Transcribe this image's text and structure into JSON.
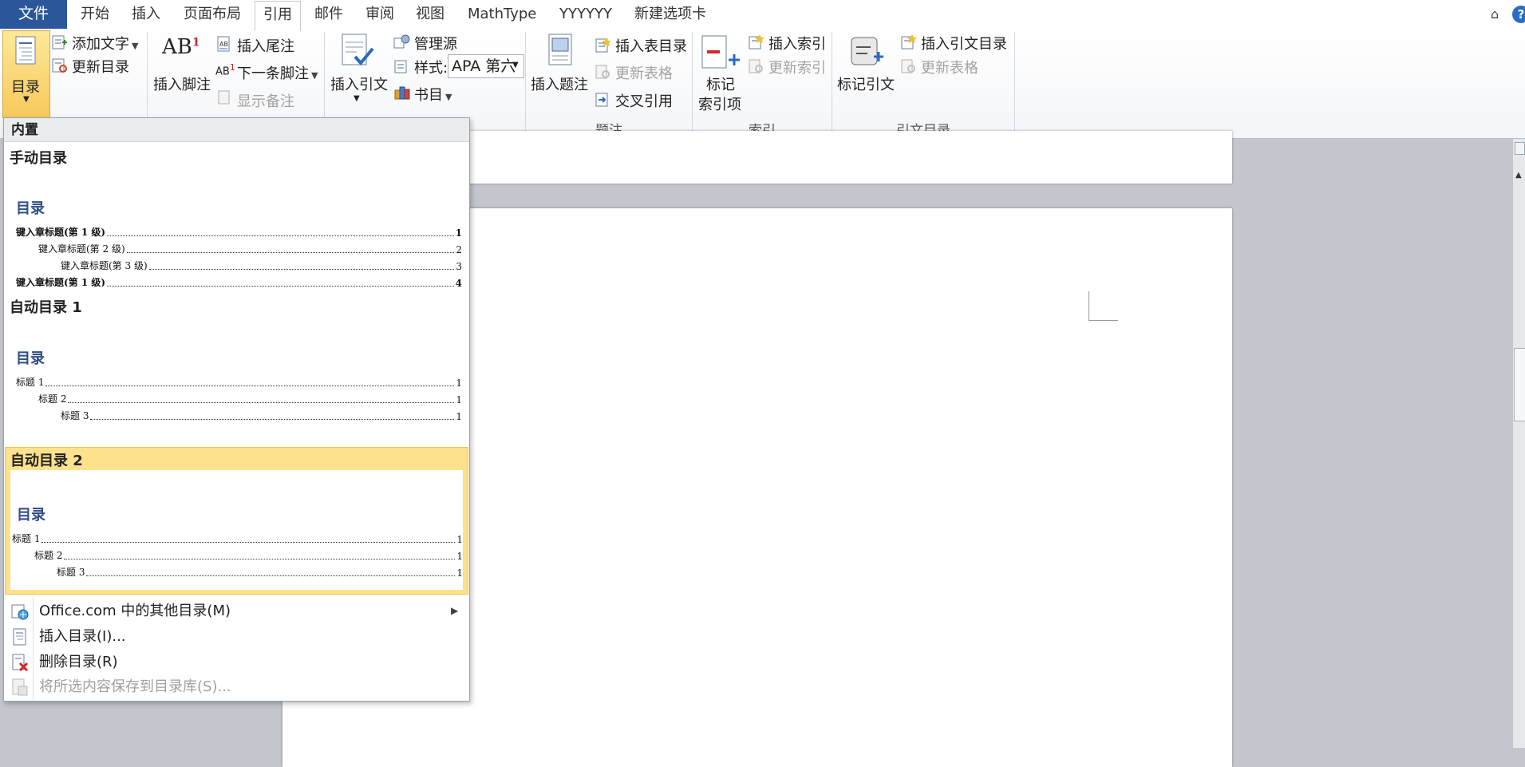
{
  "tabs": {
    "file": "文件",
    "items": [
      "开始",
      "插入",
      "页面布局",
      "引用",
      "邮件",
      "审阅",
      "视图",
      "MathType",
      "YYYYYY",
      "新建选项卡"
    ],
    "active_index": 3
  },
  "ribbon": {
    "toc_btn": "目录",
    "add_text": "添加文字",
    "update_toc": "更新目录",
    "insert_footnote": "插入脚注",
    "insert_endnote": "插入尾注",
    "next_footnote": "下一条脚注",
    "show_notes": "显示备注",
    "insert_citation": "插入引文",
    "manage_sources": "管理源",
    "style_label": "样式:",
    "style_value": "APA 第六",
    "bibliography": "书目",
    "insert_caption": "插入题注",
    "insert_table_of_figures": "插入表目录",
    "update_table": "更新表格",
    "cross_reference": "交叉引用",
    "group_captions": "题注",
    "mark_entry_1": "标记",
    "mark_entry_2": "索引项",
    "insert_index": "插入索引",
    "update_index": "更新索引",
    "group_index": "索引",
    "mark_citation": "标记引文",
    "insert_toa": "插入引文目录",
    "update_table2": "更新表格",
    "group_toa": "引文目录"
  },
  "dropdown": {
    "header": "内置",
    "manual": {
      "title": "手动目录",
      "toc_heading": "目录",
      "lines": [
        {
          "text": "键入章标题(第 1 级)",
          "page": "1"
        },
        {
          "text": "键入章标题(第 2 级)",
          "page": "2"
        },
        {
          "text": "键入章标题(第 3 级)",
          "page": "3"
        },
        {
          "text": "键入章标题(第 1 级)",
          "page": "4"
        }
      ]
    },
    "auto1": {
      "title": "自动目录 1",
      "toc_heading": "目录",
      "lines": [
        {
          "text": "标题 1",
          "page": "1"
        },
        {
          "text": "标题 2",
          "page": "1"
        },
        {
          "text": "标题 3",
          "page": "1"
        }
      ]
    },
    "auto2": {
      "title": "自动目录 2",
      "toc_heading": "目录",
      "lines": [
        {
          "text": "标题 1",
          "page": "1"
        },
        {
          "text": "标题 2",
          "page": "1"
        },
        {
          "text": "标题 3",
          "page": "1"
        }
      ]
    },
    "menu": {
      "office_more": "Office.com 中的其他目录(M)",
      "insert_toc": "插入目录(I)...",
      "remove_toc": "删除目录(R)",
      "save_selection": "将所选内容保存到目录库(S)..."
    }
  },
  "colors": {
    "file_tab": "#2b579a",
    "selected_gallery": "#fde28b",
    "toc_heading": "#2f4c86"
  }
}
